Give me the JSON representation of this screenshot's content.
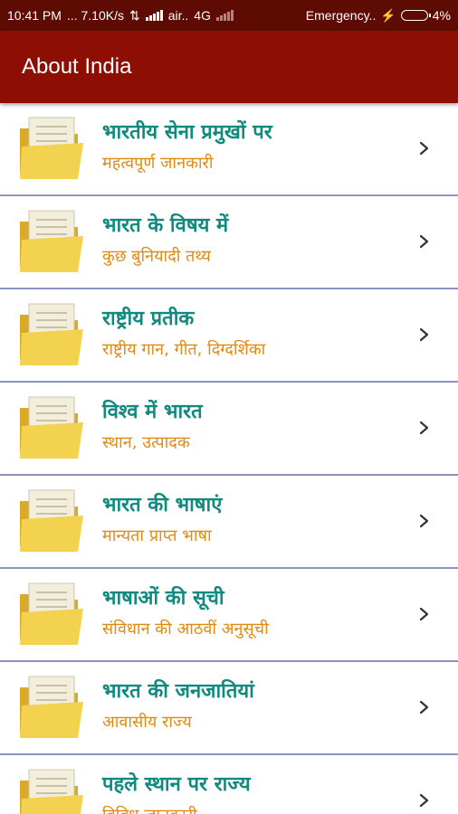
{
  "status_bar": {
    "time": "10:41 PM",
    "speed": "... 7.10K/s",
    "carrier": "air..",
    "network": "4G",
    "emergency": "Emergency..",
    "battery": "4%"
  },
  "app_bar": {
    "title": "About India"
  },
  "list": {
    "items": [
      {
        "title": "भारतीय सेना प्रमुखों पर",
        "subtitle": "महत्वपूर्ण जानकारी"
      },
      {
        "title": "भारत के विषय में",
        "subtitle": "कुछ बुनियादी तथ्य"
      },
      {
        "title": "राष्ट्रीय प्रतीक",
        "subtitle": "राष्ट्रीय गान, गीत, दिग्दर्शिका"
      },
      {
        "title": "विश्व में भारत",
        "subtitle": "स्थान, उत्पादक"
      },
      {
        "title": "भारत की भाषाएं",
        "subtitle": "मान्यता प्राप्त भाषा"
      },
      {
        "title": "भाषाओं की सूची",
        "subtitle": "संविधान की आठवीं अनुसूची"
      },
      {
        "title": "भारत की जनजातियां",
        "subtitle": "आवासीय राज्य"
      },
      {
        "title": "पहले स्थान पर राज्य",
        "subtitle": "विविध जानकारी"
      }
    ]
  },
  "colors": {
    "status_bar_bg": "#5e0b04",
    "app_bar_bg": "#8d0e02",
    "title_text": "#0f8a7e",
    "subtitle_text": "#e08a12",
    "divider": "#8c95bf",
    "folder_yellow": "#f3d250"
  },
  "icons": {
    "item_icon": "folder-icon",
    "item_arrow": "chevron-right-icon"
  }
}
